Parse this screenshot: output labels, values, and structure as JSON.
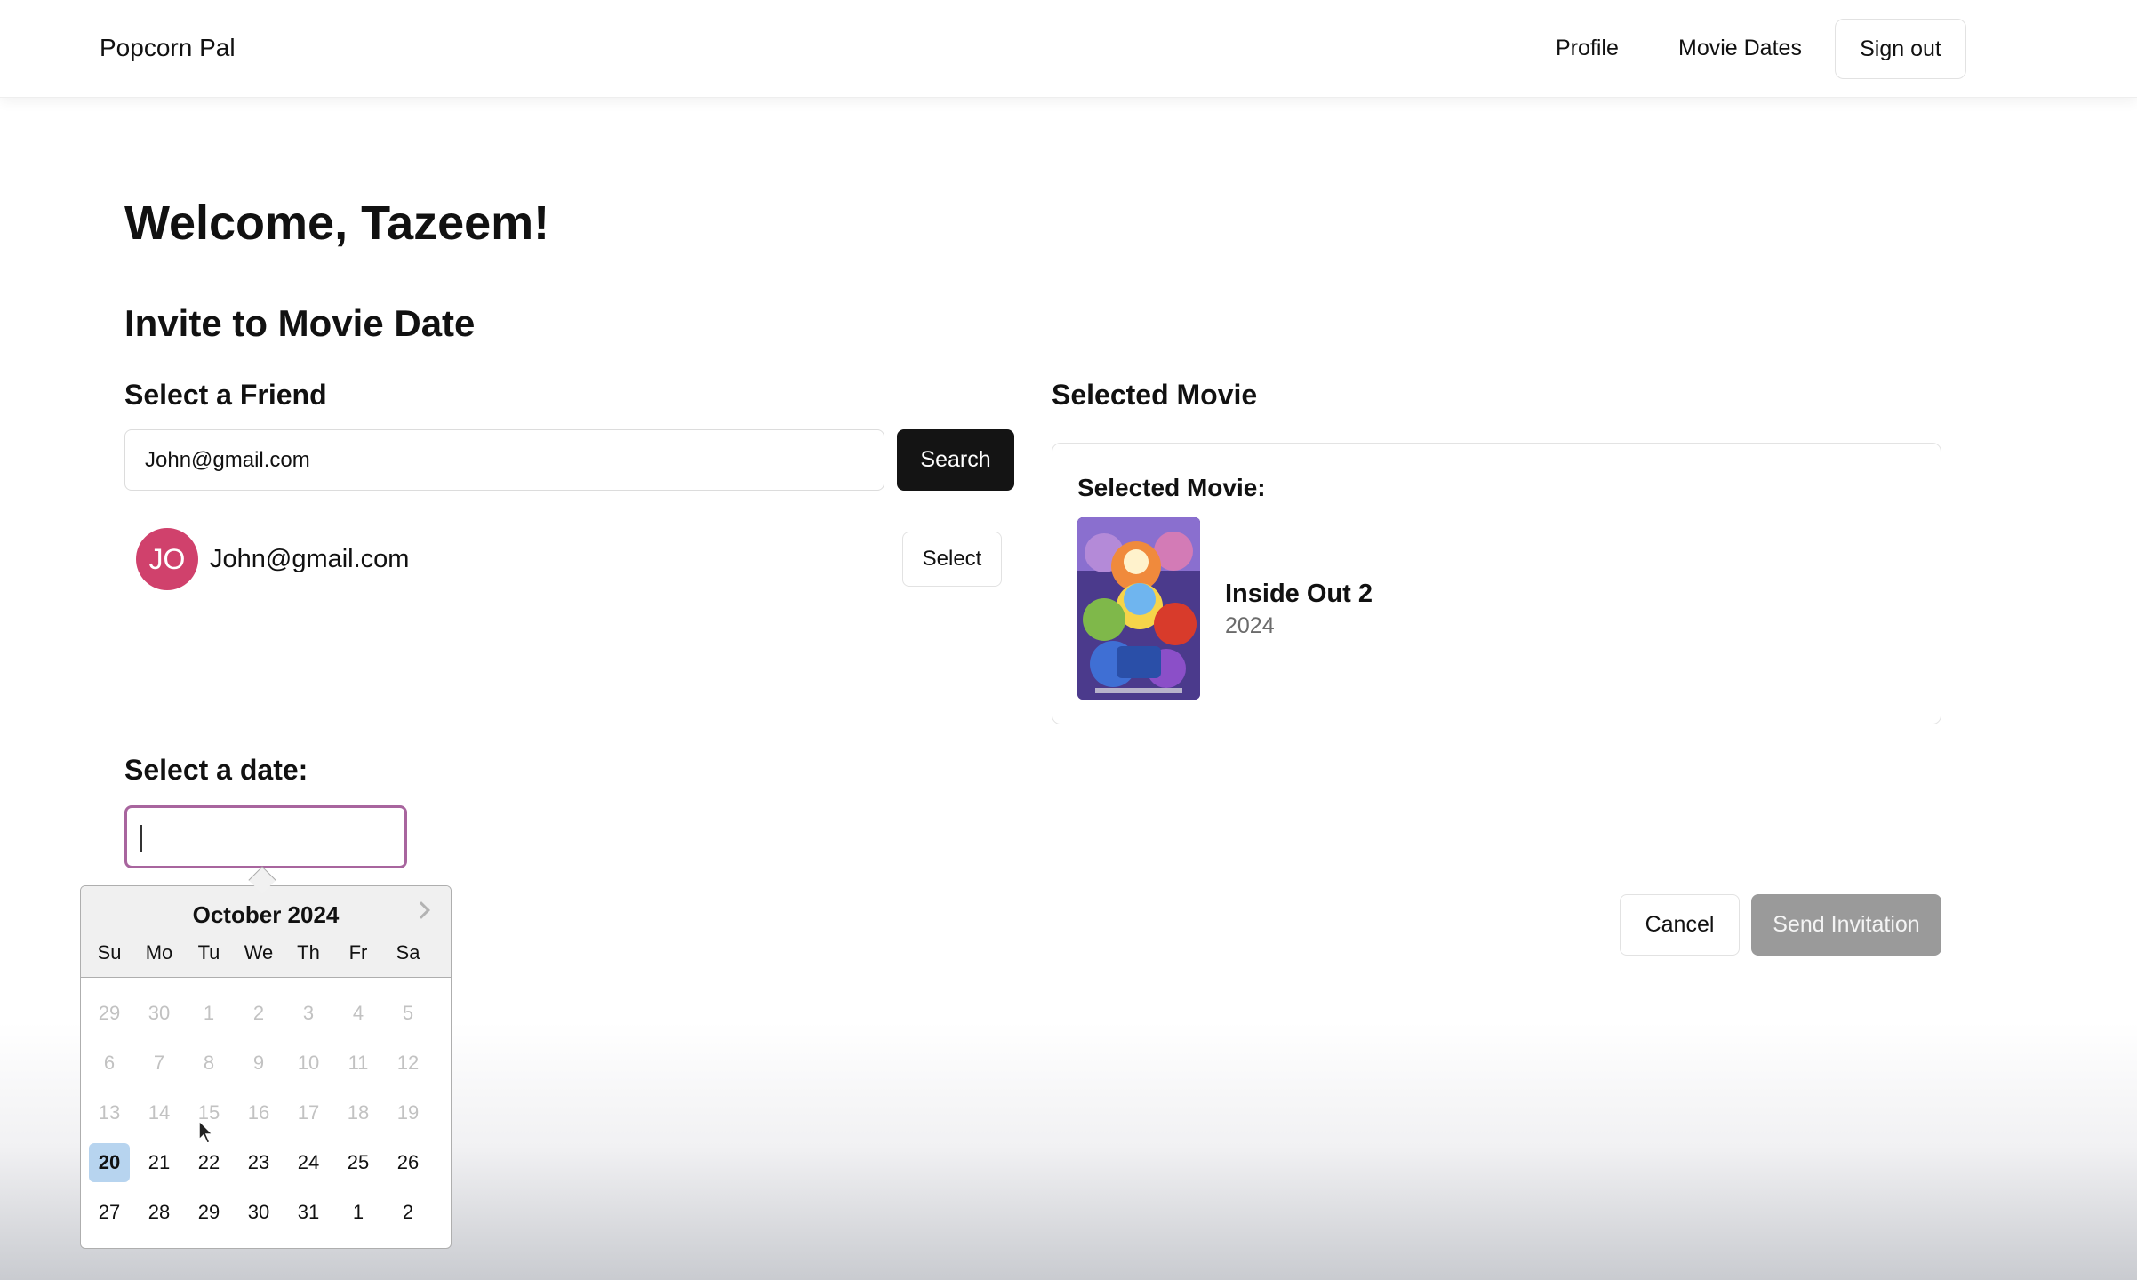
{
  "navbar": {
    "brand": "Popcorn Pal",
    "profile_link": "Profile",
    "movie_dates_link": "Movie Dates",
    "sign_out": "Sign out"
  },
  "main": {
    "welcome": "Welcome, Tazeem!",
    "invite_title": "Invite to Movie Date"
  },
  "friend_section": {
    "label": "Select a Friend",
    "search_value": "John@gmail.com",
    "search_button": "Search",
    "result": {
      "initials": "JO",
      "email": "John@gmail.com",
      "select_button": "Select",
      "avatar_color": "#d0416c"
    }
  },
  "movie_section": {
    "label": "Selected Movie",
    "card_title": "Selected Movie:",
    "movie": {
      "title": "Inside Out 2",
      "year": "2024"
    }
  },
  "date_section": {
    "label": "Select a date:",
    "input_value": ""
  },
  "calendar": {
    "month_label": "October 2024",
    "weekdays": [
      "Su",
      "Mo",
      "Tu",
      "We",
      "Th",
      "Fr",
      "Sa"
    ],
    "weeks": [
      [
        "29",
        "30",
        "1",
        "2",
        "3",
        "4",
        "5"
      ],
      [
        "6",
        "7",
        "8",
        "9",
        "10",
        "11",
        "12"
      ],
      [
        "13",
        "14",
        "15",
        "16",
        "17",
        "18",
        "19"
      ],
      [
        "20",
        "21",
        "22",
        "23",
        "24",
        "25",
        "26"
      ],
      [
        "27",
        "28",
        "29",
        "30",
        "31",
        "1",
        "2"
      ]
    ],
    "selected_day": "20",
    "first_enabled_week": 3,
    "selected_color": "#b7d4ef"
  },
  "actions": {
    "cancel": "Cancel",
    "send_invitation": "Send Invitation",
    "send_disabled": true
  },
  "colors": {
    "primary_button": "#141414",
    "date_focus_border": "#a8659e",
    "disabled_button": "#9a9a9a"
  }
}
